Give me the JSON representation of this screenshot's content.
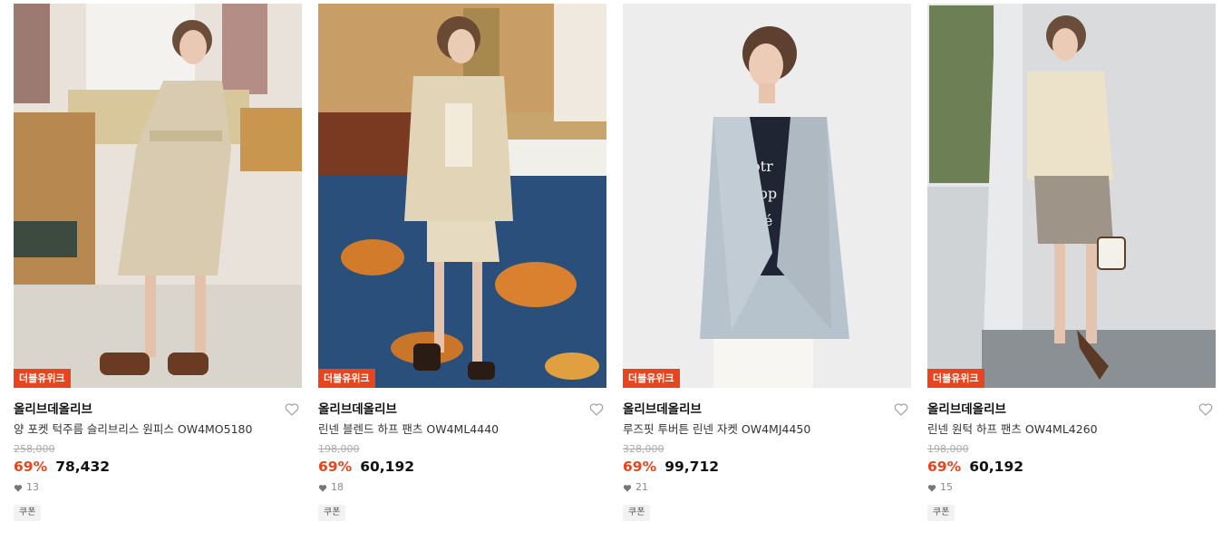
{
  "products": [
    {
      "badge": "더블유위크",
      "brand": "올리브데올리브",
      "name": "양 포켓 턱주름 슬리브리스 원피스 OW4MO5180",
      "original_price": "258,000",
      "discount": "69%",
      "price": "78,432",
      "likes": "13",
      "coupon": "쿠폰",
      "image_desc_icon": "photo-dress-model"
    },
    {
      "badge": "더블유위크",
      "brand": "올리브데올리브",
      "name": "린넨 블렌드 하프 팬츠 OW4ML4440",
      "original_price": "198,000",
      "discount": "69%",
      "price": "60,192",
      "likes": "18",
      "coupon": "쿠폰",
      "image_desc_icon": "photo-linen-set-model"
    },
    {
      "badge": "더블유위크",
      "brand": "올리브데올리브",
      "name": "루즈핏 투버튼 린넨 자켓 OW4MJ4450",
      "original_price": "328,000",
      "discount": "69%",
      "price": "99,712",
      "likes": "21",
      "coupon": "쿠폰",
      "image_desc_icon": "photo-jacket-model"
    },
    {
      "badge": "더블유위크",
      "brand": "올리브데올리브",
      "name": "린넨 원턱 하프 팬츠 OW4ML4260",
      "original_price": "198,000",
      "discount": "69%",
      "price": "60,192",
      "likes": "15",
      "coupon": "쿠폰",
      "image_desc_icon": "photo-shorts-model"
    }
  ],
  "colors": {
    "accent": "#e8441e",
    "text": "#111111",
    "muted": "#aaaaaa"
  }
}
